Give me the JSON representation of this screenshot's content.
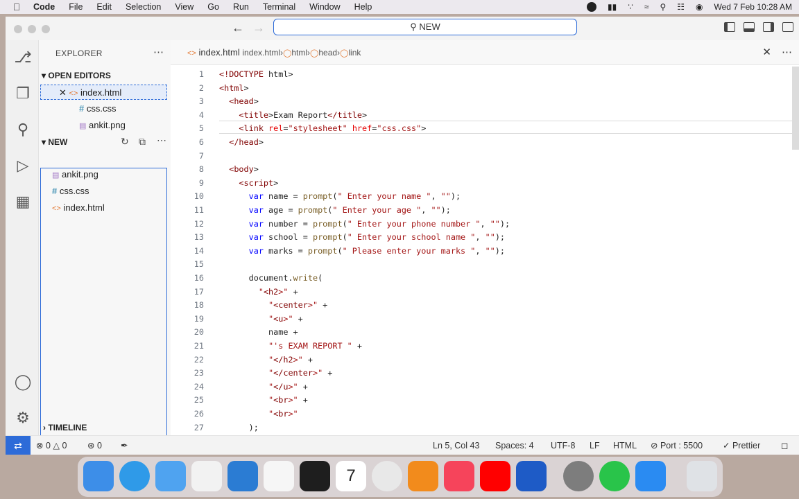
{
  "menubar": {
    "app_name": "Code",
    "items": [
      "File",
      "Edit",
      "Selection",
      "View",
      "Go",
      "Run",
      "Terminal",
      "Window",
      "Help"
    ],
    "datetime": "Wed 7 Feb  10:28 AM"
  },
  "titlebar": {
    "command_center": "NEW"
  },
  "sidebar": {
    "title": "EXPLORER",
    "open_editors_label": "OPEN EDITORS",
    "open_editors": [
      {
        "name": "index.html"
      },
      {
        "name": "css.css"
      },
      {
        "name": "ankit.png"
      }
    ],
    "folder_label": "NEW",
    "files": [
      {
        "name": "ankit.png"
      },
      {
        "name": "css.css"
      },
      {
        "name": "index.html"
      }
    ],
    "timeline_label": "TIMELINE"
  },
  "editor": {
    "tab_name": "index.html",
    "breadcrumb": [
      "index.html",
      "html",
      "head",
      "link"
    ],
    "lines": [
      {
        "n": "1",
        "text": "<!DOCTYPE html>"
      },
      {
        "n": "2",
        "text": "<html>"
      },
      {
        "n": "3",
        "text": "  <head>"
      },
      {
        "n": "4",
        "text": "    <title>Exam Report</title>"
      },
      {
        "n": "5",
        "text": "    <link rel=\"stylesheet\" href=\"css.css\">"
      },
      {
        "n": "6",
        "text": "  </head>"
      },
      {
        "n": "7",
        "text": ""
      },
      {
        "n": "8",
        "text": "  <body>"
      },
      {
        "n": "9",
        "text": "    <script>"
      },
      {
        "n": "10",
        "text": "      var name = prompt(\" Enter your name \", \"\");"
      },
      {
        "n": "11",
        "text": "      var age = prompt(\" Enter your age \", \"\");"
      },
      {
        "n": "12",
        "text": "      var number = prompt(\" Enter your phone number \", \"\");"
      },
      {
        "n": "13",
        "text": "      var school = prompt(\" Enter your school name \", \"\");"
      },
      {
        "n": "14",
        "text": "      var marks = prompt(\" Please enter your marks \", \"\");"
      },
      {
        "n": "15",
        "text": ""
      },
      {
        "n": "16",
        "text": "      document.write("
      },
      {
        "n": "17",
        "text": "        \"<h2>\" +"
      },
      {
        "n": "18",
        "text": "          \"<center>\" +"
      },
      {
        "n": "19",
        "text": "          \"<u>\" +"
      },
      {
        "n": "20",
        "text": "          name +"
      },
      {
        "n": "21",
        "text": "          \"'s EXAM REPORT \" +"
      },
      {
        "n": "22",
        "text": "          \"</h2>\" +"
      },
      {
        "n": "23",
        "text": "          \"</center>\" +"
      },
      {
        "n": "24",
        "text": "          \"</u>\" +"
      },
      {
        "n": "25",
        "text": "          \"<br>\" +"
      },
      {
        "n": "26",
        "text": "          \"<br>\""
      },
      {
        "n": "27",
        "text": "      );"
      }
    ]
  },
  "statusbar": {
    "errors": "0",
    "warnings": "0",
    "ports": "0",
    "position": "Ln 5, Col 43",
    "spaces": "Spaces: 4",
    "encoding": "UTF-8",
    "eol": "LF",
    "language": "HTML",
    "port": "Port : 5500",
    "prettier": "Prettier"
  },
  "colors": {
    "accent": "#2d6bd8",
    "tag": "#800000",
    "attribute": "#e50000",
    "string": "#a31515",
    "keyword": "#0000ff"
  },
  "dock": {
    "apps": [
      "finder-icon",
      "safari-icon",
      "mail-icon",
      "photos-icon",
      "vscode-icon",
      "home-icon",
      "figma-icon",
      "calendar-icon",
      "chrome-icon",
      "vlc-icon",
      "music-icon",
      "youtube-icon",
      "word-icon",
      "settings-icon",
      "whatsapp-icon",
      "appstore-icon",
      "trash-icon"
    ],
    "calendar_day": "7"
  }
}
